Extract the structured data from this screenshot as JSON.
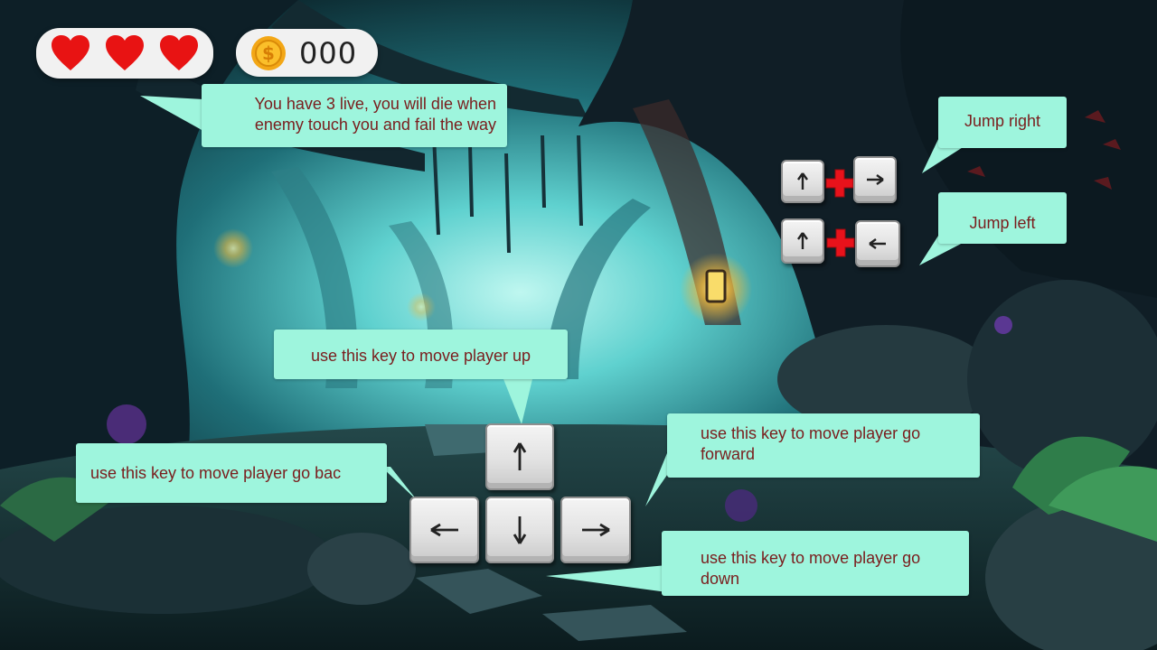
{
  "hud": {
    "lives": 3,
    "coin_count": "000",
    "heart_color": "#e81313",
    "coin_color": "#f3a716"
  },
  "tooltips": {
    "lives_info": [
      "You have 3 live, you will die when",
      "enemy touch you and fail the way"
    ],
    "jump_right": "Jump right",
    "jump_left": "Jump left",
    "move_up": "use this key to move player up",
    "move_back": "use this key to move player go bac",
    "move_forward": [
      "use this key to move player go",
      "forward"
    ],
    "move_down": [
      "use this key to move player go",
      "down"
    ]
  },
  "keys": {
    "up_icon": "arrow-up-icon",
    "down_icon": "arrow-down-icon",
    "left_icon": "arrow-left-icon",
    "right_icon": "arrow-right-icon"
  },
  "colors": {
    "bubble_bg": "#9ef5dd",
    "bubble_text": "#7a1d1d",
    "plus_color": "#e8121b"
  }
}
